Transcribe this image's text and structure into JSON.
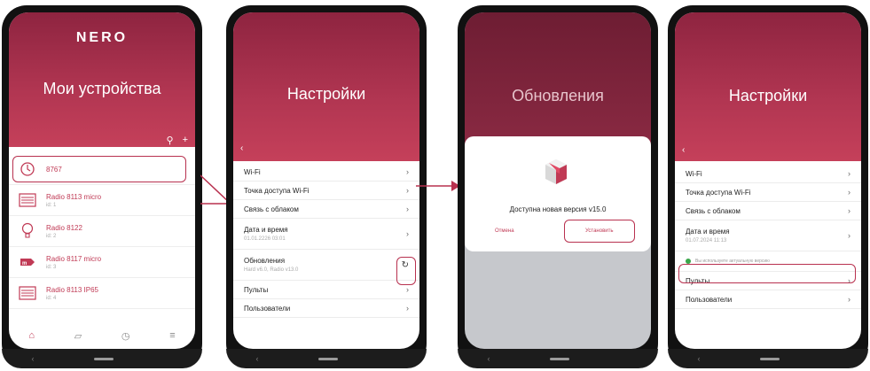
{
  "phone1": {
    "brand": "NERO",
    "title": "Мои устройства",
    "devices": [
      {
        "name": "8767",
        "id": ""
      },
      {
        "name": "Radio 8113 micro",
        "id": "id: 1"
      },
      {
        "name": "Radio 8122",
        "id": "id: 2"
      },
      {
        "name": "Radio 8117 micro",
        "id": "id: 3"
      },
      {
        "name": "Radio 8113 IP65",
        "id": "id: 4"
      }
    ]
  },
  "phone2": {
    "title": "Настройки",
    "items": [
      {
        "label": "Wi-Fi",
        "sub": ""
      },
      {
        "label": "Точка доступа Wi-Fi",
        "sub": ""
      },
      {
        "label": "Связь с облаком",
        "sub": ""
      },
      {
        "label": "Дата и время",
        "sub": "01.01.2226 03:01"
      },
      {
        "label": "Обновления",
        "sub": "Hard v6.0, Radio v13.0"
      },
      {
        "label": "Пульты",
        "sub": ""
      },
      {
        "label": "Пользователи",
        "sub": ""
      }
    ]
  },
  "phone3": {
    "title": "Обновления",
    "dialog_text": "Доступна новая версия v15.0",
    "cancel": "Отмена",
    "install": "Установить"
  },
  "phone4": {
    "title": "Настройки",
    "items": [
      {
        "label": "Wi-Fi",
        "sub": ""
      },
      {
        "label": "Точка доступа Wi-Fi",
        "sub": ""
      },
      {
        "label": "Связь с облаком",
        "sub": ""
      },
      {
        "label": "Дата и время",
        "sub": "01.07.2024 11:13"
      },
      {
        "label": "Пульты",
        "sub": ""
      },
      {
        "label": "Пользователи",
        "sub": ""
      }
    ],
    "toast": "Вы используете актуальную версию"
  },
  "colors": {
    "accent": "#b8314f",
    "header": "#8e2440"
  }
}
